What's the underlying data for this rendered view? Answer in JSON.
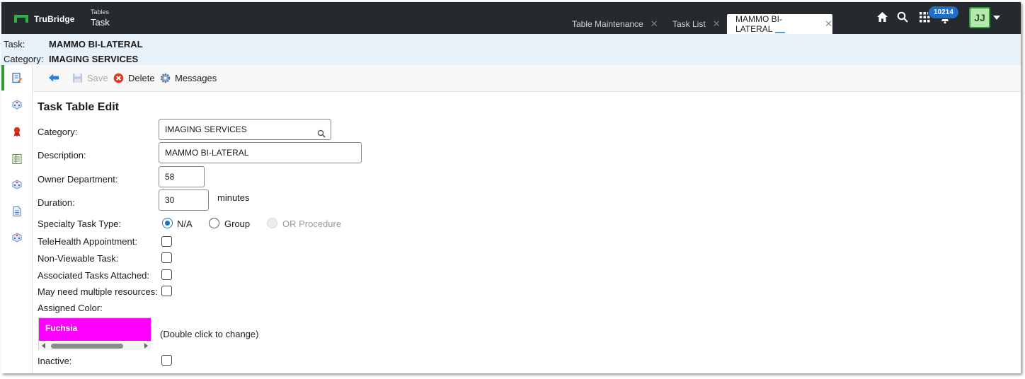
{
  "topbar": {
    "brand": "TruBridge",
    "module_small": "Tables",
    "module_big": "Task",
    "tabs": [
      {
        "label": "Table Maintenance",
        "close": "✕"
      },
      {
        "label": "Task List",
        "close": "✕"
      },
      {
        "label": "MAMMO BI-LATERAL",
        "close": "✕"
      }
    ],
    "notification_count": "10214",
    "user_initials": "JJ",
    "icons": [
      "home-icon",
      "search-icon",
      "apps-grid-icon",
      "bell-icon",
      "chevron-down-icon"
    ]
  },
  "header": {
    "task_label": "Task:",
    "task_value": "MAMMO BI-LATERAL",
    "category_label": "Category:",
    "category_value": "IMAGING SERVICES"
  },
  "rail": {
    "icons": [
      "edit-document-icon",
      "dice-icon",
      "ribbon-icon",
      "list-icon",
      "dice-icon",
      "document-icon",
      "dice-icon"
    ]
  },
  "toolbar": {
    "back_icon": "back-arrow-icon",
    "save_label": "Save",
    "delete_label": "Delete",
    "messages_label": "Messages"
  },
  "form": {
    "title": "Task Table Edit",
    "category_label": "Category:",
    "category_value": "IMAGING SERVICES",
    "description_label": "Description:",
    "description_value": "MAMMO BI-LATERAL",
    "owner_department_label": "Owner Department:",
    "owner_department_value": "58",
    "duration_label": "Duration:",
    "duration_value": "30",
    "duration_suffix": "minutes",
    "specialty_label": "Specialty Task Type:",
    "specialty_options": [
      {
        "label": "N/A",
        "checked": true,
        "disabled": false
      },
      {
        "label": "Group",
        "checked": false,
        "disabled": false
      },
      {
        "label": "OR Procedure",
        "checked": false,
        "disabled": true
      }
    ],
    "telehealth_label": "TeleHealth Appointment:",
    "nonviewable_label": "Non-Viewable Task:",
    "associated_label": "Associated Tasks Attached:",
    "multiple_resources_label": "May need multiple resources:",
    "assigned_color_label": "Assigned Color:",
    "assigned_color_value": "Fuchsia",
    "assigned_color_hex": "#ff00ff",
    "color_hint": "(Double click to change)",
    "inactive_label": "Inactive:"
  },
  "colors": {
    "topbar_bg": "#262a2e",
    "accent_green": "#2f9b3a",
    "info_bg": "#e7f1f9",
    "badge_blue": "#1d6fc7"
  }
}
